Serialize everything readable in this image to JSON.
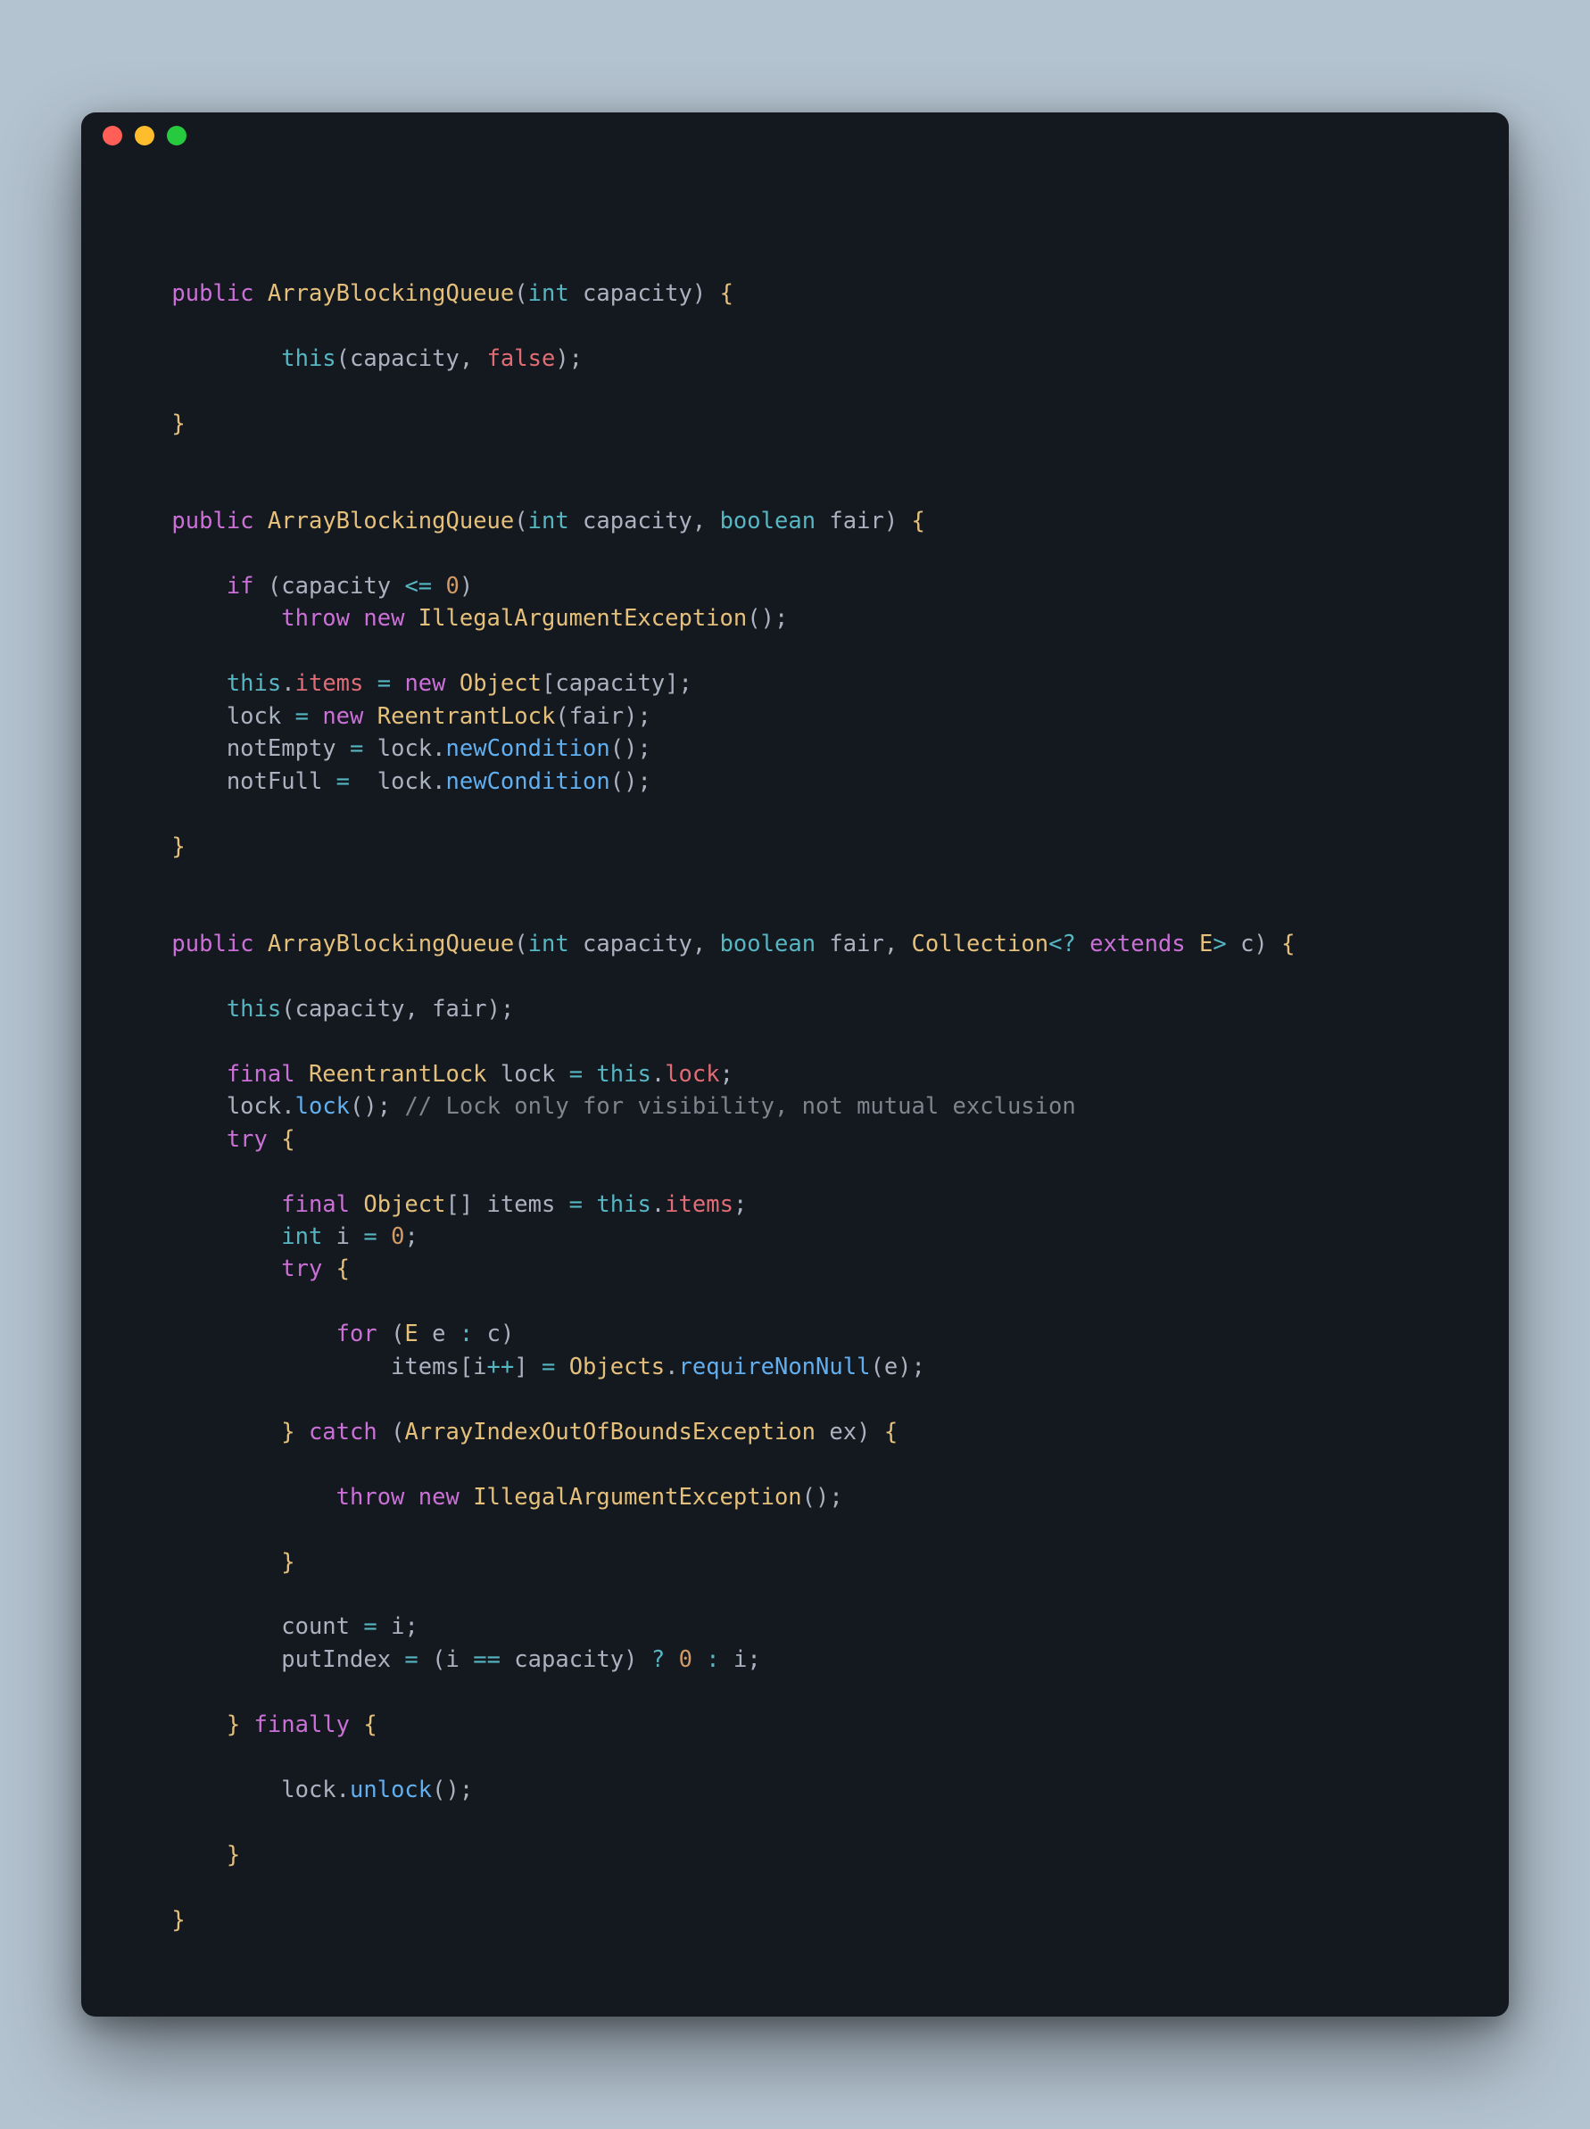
{
  "window": {
    "traffic_lights": [
      "close",
      "minimize",
      "zoom"
    ]
  },
  "code": {
    "tokens": [
      [
        [
          "plain",
          "\n"
        ]
      ],
      [
        [
          "plain",
          "    "
        ],
        [
          "kw",
          "public"
        ],
        [
          "plain",
          " "
        ],
        [
          "class",
          "ArrayBlockingQueue"
        ],
        [
          "punc",
          "("
        ],
        [
          "type",
          "int"
        ],
        [
          "plain",
          " "
        ],
        [
          "ident",
          "capacity"
        ],
        [
          "punc",
          ") "
        ],
        [
          "brace",
          "{"
        ]
      ],
      [
        [
          "plain",
          ""
        ]
      ],
      [
        [
          "plain",
          "            "
        ],
        [
          "type",
          "this"
        ],
        [
          "punc",
          "("
        ],
        [
          "ident",
          "capacity"
        ],
        [
          "punc",
          ", "
        ],
        [
          "false",
          "false"
        ],
        [
          "punc",
          ");"
        ]
      ],
      [
        [
          "plain",
          ""
        ]
      ],
      [
        [
          "plain",
          "    "
        ],
        [
          "brace",
          "}"
        ]
      ],
      [
        [
          "plain",
          ""
        ]
      ],
      [
        [
          "plain",
          ""
        ]
      ],
      [
        [
          "plain",
          "    "
        ],
        [
          "kw",
          "public"
        ],
        [
          "plain",
          " "
        ],
        [
          "class",
          "ArrayBlockingQueue"
        ],
        [
          "punc",
          "("
        ],
        [
          "type",
          "int"
        ],
        [
          "plain",
          " "
        ],
        [
          "ident",
          "capacity"
        ],
        [
          "punc",
          ", "
        ],
        [
          "type",
          "boolean"
        ],
        [
          "plain",
          " "
        ],
        [
          "ident",
          "fair"
        ],
        [
          "punc",
          ") "
        ],
        [
          "brace",
          "{"
        ]
      ],
      [
        [
          "plain",
          ""
        ]
      ],
      [
        [
          "plain",
          "        "
        ],
        [
          "kw",
          "if"
        ],
        [
          "plain",
          " "
        ],
        [
          "punc",
          "("
        ],
        [
          "ident",
          "capacity"
        ],
        [
          "plain",
          " "
        ],
        [
          "op",
          "<="
        ],
        [
          "plain",
          " "
        ],
        [
          "const",
          "0"
        ],
        [
          "punc",
          ")"
        ]
      ],
      [
        [
          "plain",
          "            "
        ],
        [
          "kw",
          "throw"
        ],
        [
          "plain",
          " "
        ],
        [
          "kw",
          "new"
        ],
        [
          "plain",
          " "
        ],
        [
          "class",
          "IllegalArgumentException"
        ],
        [
          "punc",
          "();"
        ]
      ],
      [
        [
          "plain",
          ""
        ]
      ],
      [
        [
          "plain",
          "        "
        ],
        [
          "type",
          "this"
        ],
        [
          "punc",
          "."
        ],
        [
          "var",
          "items"
        ],
        [
          "plain",
          " "
        ],
        [
          "op",
          "="
        ],
        [
          "plain",
          " "
        ],
        [
          "kw",
          "new"
        ],
        [
          "plain",
          " "
        ],
        [
          "class",
          "Object"
        ],
        [
          "punc",
          "["
        ],
        [
          "ident",
          "capacity"
        ],
        [
          "punc",
          "];"
        ]
      ],
      [
        [
          "plain",
          "        "
        ],
        [
          "ident",
          "lock"
        ],
        [
          "plain",
          " "
        ],
        [
          "op",
          "="
        ],
        [
          "plain",
          " "
        ],
        [
          "kw",
          "new"
        ],
        [
          "plain",
          " "
        ],
        [
          "class",
          "ReentrantLock"
        ],
        [
          "punc",
          "("
        ],
        [
          "ident",
          "fair"
        ],
        [
          "punc",
          ");"
        ]
      ],
      [
        [
          "plain",
          "        "
        ],
        [
          "ident",
          "notEmpty"
        ],
        [
          "plain",
          " "
        ],
        [
          "op",
          "="
        ],
        [
          "plain",
          " "
        ],
        [
          "ident",
          "lock"
        ],
        [
          "punc",
          "."
        ],
        [
          "func",
          "newCondition"
        ],
        [
          "punc",
          "();"
        ]
      ],
      [
        [
          "plain",
          "        "
        ],
        [
          "ident",
          "notFull"
        ],
        [
          "plain",
          " "
        ],
        [
          "op",
          "="
        ],
        [
          "plain",
          "  "
        ],
        [
          "ident",
          "lock"
        ],
        [
          "punc",
          "."
        ],
        [
          "func",
          "newCondition"
        ],
        [
          "punc",
          "();"
        ]
      ],
      [
        [
          "plain",
          ""
        ]
      ],
      [
        [
          "plain",
          "    "
        ],
        [
          "brace",
          "}"
        ]
      ],
      [
        [
          "plain",
          ""
        ]
      ],
      [
        [
          "plain",
          ""
        ]
      ],
      [
        [
          "plain",
          "    "
        ],
        [
          "kw",
          "public"
        ],
        [
          "plain",
          " "
        ],
        [
          "class",
          "ArrayBlockingQueue"
        ],
        [
          "punc",
          "("
        ],
        [
          "type",
          "int"
        ],
        [
          "plain",
          " "
        ],
        [
          "ident",
          "capacity"
        ],
        [
          "punc",
          ", "
        ],
        [
          "type",
          "boolean"
        ],
        [
          "plain",
          " "
        ],
        [
          "ident",
          "fair"
        ],
        [
          "punc",
          ", "
        ],
        [
          "class",
          "Collection"
        ],
        [
          "op",
          "<?"
        ],
        [
          "plain",
          " "
        ],
        [
          "kw",
          "extends"
        ],
        [
          "plain",
          " "
        ],
        [
          "class",
          "E"
        ],
        [
          "op",
          ">"
        ],
        [
          "plain",
          " "
        ],
        [
          "ident",
          "c"
        ],
        [
          "punc",
          ") "
        ],
        [
          "brace",
          "{"
        ]
      ],
      [
        [
          "plain",
          ""
        ]
      ],
      [
        [
          "plain",
          "        "
        ],
        [
          "type",
          "this"
        ],
        [
          "punc",
          "("
        ],
        [
          "ident",
          "capacity"
        ],
        [
          "punc",
          ", "
        ],
        [
          "ident",
          "fair"
        ],
        [
          "punc",
          ");"
        ]
      ],
      [
        [
          "plain",
          ""
        ]
      ],
      [
        [
          "plain",
          "        "
        ],
        [
          "kw",
          "final"
        ],
        [
          "plain",
          " "
        ],
        [
          "class",
          "ReentrantLock"
        ],
        [
          "plain",
          " "
        ],
        [
          "ident",
          "lock"
        ],
        [
          "plain",
          " "
        ],
        [
          "op",
          "="
        ],
        [
          "plain",
          " "
        ],
        [
          "type",
          "this"
        ],
        [
          "punc",
          "."
        ],
        [
          "var",
          "lock"
        ],
        [
          "punc",
          ";"
        ]
      ],
      [
        [
          "plain",
          "        "
        ],
        [
          "ident",
          "lock"
        ],
        [
          "punc",
          "."
        ],
        [
          "func",
          "lock"
        ],
        [
          "punc",
          "(); "
        ],
        [
          "comment",
          "// Lock only for visibility, not mutual exclusion"
        ]
      ],
      [
        [
          "plain",
          "        "
        ],
        [
          "kw",
          "try"
        ],
        [
          "plain",
          " "
        ],
        [
          "brace",
          "{"
        ]
      ],
      [
        [
          "plain",
          ""
        ]
      ],
      [
        [
          "plain",
          "            "
        ],
        [
          "kw",
          "final"
        ],
        [
          "plain",
          " "
        ],
        [
          "class",
          "Object"
        ],
        [
          "punc",
          "[] "
        ],
        [
          "ident",
          "items"
        ],
        [
          "plain",
          " "
        ],
        [
          "op",
          "="
        ],
        [
          "plain",
          " "
        ],
        [
          "type",
          "this"
        ],
        [
          "punc",
          "."
        ],
        [
          "var",
          "items"
        ],
        [
          "punc",
          ";"
        ]
      ],
      [
        [
          "plain",
          "            "
        ],
        [
          "type",
          "int"
        ],
        [
          "plain",
          " "
        ],
        [
          "ident",
          "i"
        ],
        [
          "plain",
          " "
        ],
        [
          "op",
          "="
        ],
        [
          "plain",
          " "
        ],
        [
          "const",
          "0"
        ],
        [
          "punc",
          ";"
        ]
      ],
      [
        [
          "plain",
          "            "
        ],
        [
          "kw",
          "try"
        ],
        [
          "plain",
          " "
        ],
        [
          "brace",
          "{"
        ]
      ],
      [
        [
          "plain",
          ""
        ]
      ],
      [
        [
          "plain",
          "                "
        ],
        [
          "kw",
          "for"
        ],
        [
          "plain",
          " "
        ],
        [
          "punc",
          "("
        ],
        [
          "class",
          "E"
        ],
        [
          "plain",
          " "
        ],
        [
          "ident",
          "e"
        ],
        [
          "plain",
          " "
        ],
        [
          "op",
          ":"
        ],
        [
          "plain",
          " "
        ],
        [
          "ident",
          "c"
        ],
        [
          "punc",
          ")"
        ]
      ],
      [
        [
          "plain",
          "                    "
        ],
        [
          "ident",
          "items"
        ],
        [
          "punc",
          "["
        ],
        [
          "ident",
          "i"
        ],
        [
          "op",
          "++"
        ],
        [
          "punc",
          "] "
        ],
        [
          "op",
          "="
        ],
        [
          "plain",
          " "
        ],
        [
          "class",
          "Objects"
        ],
        [
          "punc",
          "."
        ],
        [
          "func",
          "requireNonNull"
        ],
        [
          "punc",
          "("
        ],
        [
          "ident",
          "e"
        ],
        [
          "punc",
          ");"
        ]
      ],
      [
        [
          "plain",
          ""
        ]
      ],
      [
        [
          "plain",
          "            "
        ],
        [
          "brace",
          "}"
        ],
        [
          "plain",
          " "
        ],
        [
          "kw",
          "catch"
        ],
        [
          "plain",
          " "
        ],
        [
          "punc",
          "("
        ],
        [
          "class",
          "ArrayIndexOutOfBoundsException"
        ],
        [
          "plain",
          " "
        ],
        [
          "ident",
          "ex"
        ],
        [
          "punc",
          ") "
        ],
        [
          "brace",
          "{"
        ]
      ],
      [
        [
          "plain",
          ""
        ]
      ],
      [
        [
          "plain",
          "                "
        ],
        [
          "kw",
          "throw"
        ],
        [
          "plain",
          " "
        ],
        [
          "kw",
          "new"
        ],
        [
          "plain",
          " "
        ],
        [
          "class",
          "IllegalArgumentException"
        ],
        [
          "punc",
          "();"
        ]
      ],
      [
        [
          "plain",
          ""
        ]
      ],
      [
        [
          "plain",
          "            "
        ],
        [
          "brace",
          "}"
        ]
      ],
      [
        [
          "plain",
          ""
        ]
      ],
      [
        [
          "plain",
          "            "
        ],
        [
          "ident",
          "count"
        ],
        [
          "plain",
          " "
        ],
        [
          "op",
          "="
        ],
        [
          "plain",
          " "
        ],
        [
          "ident",
          "i"
        ],
        [
          "punc",
          ";"
        ]
      ],
      [
        [
          "plain",
          "            "
        ],
        [
          "ident",
          "putIndex"
        ],
        [
          "plain",
          " "
        ],
        [
          "op",
          "="
        ],
        [
          "plain",
          " "
        ],
        [
          "punc",
          "("
        ],
        [
          "ident",
          "i"
        ],
        [
          "plain",
          " "
        ],
        [
          "op",
          "=="
        ],
        [
          "plain",
          " "
        ],
        [
          "ident",
          "capacity"
        ],
        [
          "punc",
          ") "
        ],
        [
          "op",
          "?"
        ],
        [
          "plain",
          " "
        ],
        [
          "const",
          "0"
        ],
        [
          "plain",
          " "
        ],
        [
          "op",
          ":"
        ],
        [
          "plain",
          " "
        ],
        [
          "ident",
          "i"
        ],
        [
          "punc",
          ";"
        ]
      ],
      [
        [
          "plain",
          ""
        ]
      ],
      [
        [
          "plain",
          "        "
        ],
        [
          "brace",
          "}"
        ],
        [
          "plain",
          " "
        ],
        [
          "kw",
          "finally"
        ],
        [
          "plain",
          " "
        ],
        [
          "brace",
          "{"
        ]
      ],
      [
        [
          "plain",
          ""
        ]
      ],
      [
        [
          "plain",
          "            "
        ],
        [
          "ident",
          "lock"
        ],
        [
          "punc",
          "."
        ],
        [
          "func",
          "unlock"
        ],
        [
          "punc",
          "();"
        ]
      ],
      [
        [
          "plain",
          ""
        ]
      ],
      [
        [
          "plain",
          "        "
        ],
        [
          "brace",
          "}"
        ]
      ],
      [
        [
          "plain",
          ""
        ]
      ],
      [
        [
          "plain",
          "    "
        ],
        [
          "brace",
          "}"
        ]
      ]
    ]
  },
  "token_classes": {
    "kw": "tok-kw",
    "type": "tok-type",
    "class": "tok-class",
    "ident": "tok-ident",
    "var": "tok-var",
    "param": "tok-param",
    "func": "tok-func",
    "const": "tok-const",
    "op": "tok-op",
    "punc": "tok-punc",
    "brace": "tok-brace",
    "bracket": "tok-bracket",
    "comment": "tok-comment",
    "false": "tok-false",
    "plain": "tok-punc"
  }
}
